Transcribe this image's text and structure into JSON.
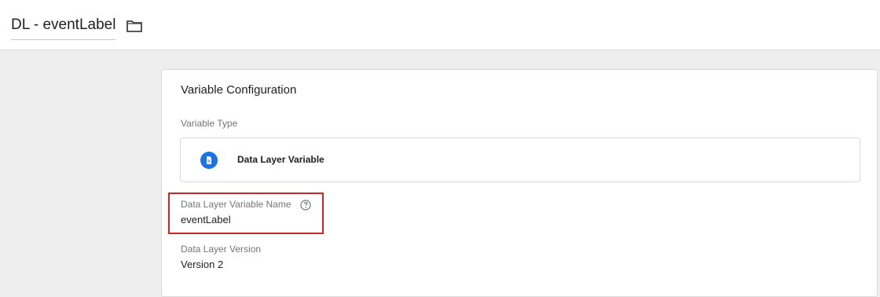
{
  "header": {
    "title": "DL - eventLabel"
  },
  "card": {
    "title": "Variable Configuration",
    "variable_type_label": "Variable Type",
    "variable_type_value": "Data Layer Variable",
    "name_label": "Data Layer Variable Name",
    "name_value": "eventLabel",
    "version_label": "Data Layer Version",
    "version_value": "Version 2"
  },
  "colors": {
    "accent": "#1a73e8",
    "highlight": "#c62828"
  },
  "icons": {
    "folder": "folder-icon",
    "type": "data-layer-variable-icon",
    "help": "help-icon"
  }
}
